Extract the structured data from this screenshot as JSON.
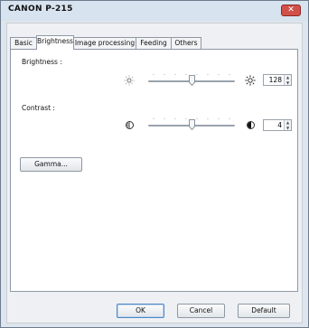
{
  "window": {
    "title": "CANON P-215",
    "close_glyph": "✕"
  },
  "tabs": [
    {
      "label": "Basic",
      "active": false
    },
    {
      "label": "Brightness",
      "active": true
    },
    {
      "label": "Image processing",
      "active": false
    },
    {
      "label": "Feeding",
      "active": false
    },
    {
      "label": "Others",
      "active": false
    }
  ],
  "brightness": {
    "label": "Brightness :",
    "value": "128",
    "slider_fraction": 0.5,
    "min_icon": "sun-dim-icon",
    "max_icon": "sun-bright-icon"
  },
  "contrast": {
    "label": "Contrast :",
    "value": "4",
    "slider_fraction": 0.5,
    "min_icon": "contrast-low-icon",
    "max_icon": "contrast-high-icon"
  },
  "gamma_button": "Gamma...",
  "footer": {
    "ok": "OK",
    "cancel": "Cancel",
    "default": "Default"
  },
  "colors": {
    "title_bar": "#d7e3ef",
    "close_button": "#d2504a",
    "panel": "#ffffff"
  }
}
